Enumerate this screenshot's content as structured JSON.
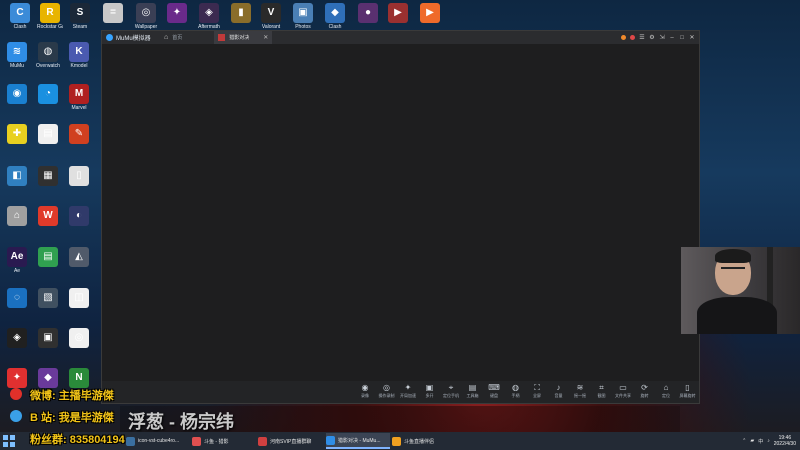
{
  "desktop": {
    "top_icons": [
      {
        "label": "Clash",
        "color": "#3b8bd8",
        "glyph": "C"
      },
      {
        "label": "Rockstar Games",
        "color": "#e8b400",
        "glyph": "R"
      },
      {
        "label": "Steam",
        "color": "#1b2838",
        "glyph": "S"
      },
      {
        "label": "",
        "color": "#c8c8c8",
        "glyph": "="
      },
      {
        "label": "Wallpaper",
        "color": "#3a3f55",
        "glyph": "◎"
      },
      {
        "label": "",
        "color": "#6a2a8a",
        "glyph": "✦"
      },
      {
        "label": "Aftermath",
        "color": "#3b2a50",
        "glyph": "◈"
      },
      {
        "label": "",
        "color": "#8a6d2a",
        "glyph": "▮"
      },
      {
        "label": "Valorant",
        "color": "#2a2a2a",
        "glyph": "V"
      },
      {
        "label": "Photos",
        "color": "#4a7fb5",
        "glyph": "▣"
      },
      {
        "label": "Clash",
        "color": "#2f6fb8",
        "glyph": "◆"
      },
      {
        "label": "",
        "color": "#5a3070",
        "glyph": "●"
      },
      {
        "label": "",
        "color": "#9a3030",
        "glyph": "▶"
      },
      {
        "label": "",
        "color": "#ef6a2a",
        "glyph": "▶"
      }
    ],
    "left_icons": [
      {
        "label": "MuMu",
        "color": "#2f8de6",
        "glyph": "≋"
      },
      {
        "label": "Overwatch",
        "color": "#2a3a4a",
        "glyph": "◍"
      },
      {
        "label": "Kmodel",
        "color": "#4a5ab0",
        "glyph": "K"
      },
      {
        "label": "",
        "color": "#1a80d0",
        "glyph": "◉"
      },
      {
        "label": "",
        "color": "#1a90e0",
        "glyph": "◔"
      },
      {
        "label": "Marvel",
        "color": "#b02020",
        "glyph": "M"
      },
      {
        "label": "",
        "color": "#e8d020",
        "glyph": "✚"
      },
      {
        "label": "",
        "color": "#f0f0f0",
        "glyph": "▤"
      },
      {
        "label": "",
        "color": "#d04020",
        "glyph": "✎"
      },
      {
        "label": "",
        "color": "#3080c0",
        "glyph": "◧"
      },
      {
        "label": "",
        "color": "#303030",
        "glyph": "▦"
      },
      {
        "label": "",
        "color": "#e0e0e0",
        "glyph": "▯"
      },
      {
        "label": "",
        "color": "#a0a0a0",
        "glyph": "⌂"
      },
      {
        "label": "",
        "color": "#e03a2a",
        "glyph": "W"
      },
      {
        "label": "",
        "color": "#303a6a",
        "glyph": "◐"
      },
      {
        "label": "Ae",
        "color": "#2a1a50",
        "glyph": "Ae"
      },
      {
        "label": "",
        "color": "#30a050",
        "glyph": "▤"
      },
      {
        "label": "",
        "color": "#505a6a",
        "glyph": "◭"
      },
      {
        "label": "",
        "color": "#1a70c0",
        "glyph": "◌"
      },
      {
        "label": "",
        "color": "#405060",
        "glyph": "▧"
      },
      {
        "label": "",
        "color": "#f0f0f0",
        "glyph": "◫"
      },
      {
        "label": "",
        "color": "#202020",
        "glyph": "◈"
      },
      {
        "label": "",
        "color": "#303030",
        "glyph": "▣"
      },
      {
        "label": "",
        "color": "#f0f0f0",
        "glyph": "◎"
      },
      {
        "label": "",
        "color": "#e03030",
        "glyph": "✦"
      },
      {
        "label": "",
        "color": "#6a3a9a",
        "glyph": "◆"
      },
      {
        "label": "",
        "color": "#2a8a3a",
        "glyph": "N"
      }
    ]
  },
  "emulator": {
    "app_name": "MuMu模拟器",
    "home_tab": "首页",
    "game_tab": "猎影对决",
    "toolbar": [
      {
        "label": "录像",
        "icon": "◉"
      },
      {
        "label": "操作录制",
        "icon": "◎"
      },
      {
        "label": "开局加速",
        "icon": "✦"
      },
      {
        "label": "多开",
        "icon": "▣"
      },
      {
        "label": "定位手机",
        "icon": "⌖"
      },
      {
        "label": "工具箱",
        "icon": "▤"
      },
      {
        "label": "键盘",
        "icon": "⌨"
      },
      {
        "label": "手柄",
        "icon": "◍"
      },
      {
        "label": "全屏",
        "icon": "⛶"
      },
      {
        "label": "音量",
        "icon": "♪"
      },
      {
        "label": "摇一摇",
        "icon": "≋"
      },
      {
        "label": "截图",
        "icon": "⌗"
      },
      {
        "label": "文件共享",
        "icon": "▭"
      },
      {
        "label": "旋转",
        "icon": "⟳"
      },
      {
        "label": "定位",
        "icon": "⌂"
      },
      {
        "label": "屏幕旋转",
        "icon": "▯"
      }
    ]
  },
  "stream_overlay": {
    "weibo_line": "微博: 主播毕游傑",
    "bilibili_line": "B 站: 我是毕游傑",
    "fans_line": "粉丝群: 835804194",
    "banner_title": "浮葱 - 杨宗纬"
  },
  "taskbar": {
    "tasks": [
      {
        "label": "icon-vst-cube4ro...",
        "color": "#3a6fa0",
        "active": false
      },
      {
        "label": "斗鱼 - 猎影",
        "color": "#e05050",
        "active": false
      },
      {
        "label": "河南SVIP直播群聊",
        "color": "#d04040",
        "active": false
      },
      {
        "label": "猎影对决 - MuMu...",
        "color": "#2f8de6",
        "active": true
      },
      {
        "label": "斗鱼直播伴侣",
        "color": "#f0a020",
        "active": false
      }
    ],
    "time": "19:46",
    "date": "2022/4/30",
    "lang": "中"
  }
}
